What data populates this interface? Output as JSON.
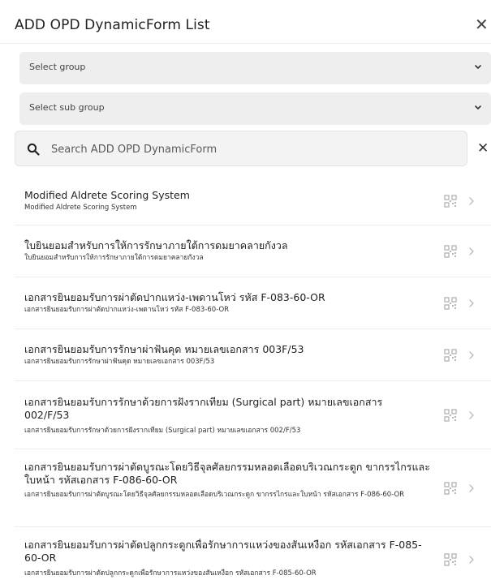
{
  "header": {
    "title": "ADD OPD DynamicForm List",
    "close_icon": "close-icon"
  },
  "filters": {
    "group_placeholder": "Select group",
    "sub_group_placeholder": "Select sub group"
  },
  "search": {
    "placeholder": "Search ADD OPD DynamicForm"
  },
  "items": [
    {
      "title": "Modified Aldrete Scoring System",
      "subtitle": "Modified Aldrete Scoring System"
    },
    {
      "title": "ใบยินยอมสำหรับการให้การรักษาภายใต้การดมยาคลายกังวล",
      "subtitle": "ใบยินยอมสำหรับการให้การรักษาภายใต้การดมยาคลายกังวล"
    },
    {
      "title": "เอกสารยินยอมรับการผ่าตัดปากแหว่ง-เพดานโหว่ รหัส F-083-60-OR",
      "subtitle": "เอกสารยินยอมรับการผ่าตัดปากแหว่ง-เพดานโหว่ รหัส F-083-60-OR"
    },
    {
      "title": "เอกสารยินยอมรับการรักษาผ่าฟันคุด หมายเลขเอกสาร 003F/53",
      "subtitle": "เอกสารยินยอมรับการรักษาผ่าฟันคุด หมายเลขเอกสาร 003F/53"
    },
    {
      "title": "เอกสารยินยอมรับการรักษาด้วยการฝังรากเทียม (Surgical part) หมายเลขเอกสาร 002/F/53",
      "subtitle": "เอกสารยินยอมรับการรักษาด้วยการฝังรากเทียม (Surgical part) หมายเลขเอกสาร 002/F/53"
    },
    {
      "title": "เอกสารยินยอมรับการผ่าตัดบูรณะโดยวิธีจุลศัลยกรรมหลอดเลือดบริเวณกระดูก ขากรรไกรและใบหน้า รหัสเอกสาร F-086-60-OR",
      "subtitle": "เอกสารยินยอมรับการผ่าตัดบูรณะโดยวิธีจุลศัลยกรรมหลอดเลือดบริเวณกระดูก ขากรรไกรและใบหน้า รหัสเอกสาร F-086-60-OR"
    },
    {
      "title": "เอกสารยินยอมรับการผ่าตัดปลูกกระดูกเพื่อรักษาการแหว่งของสันเหงือก รหัสเอกสาร F-085-60-OR",
      "subtitle": "เอกสารยินยอมรับการผ่าตัดปลูกกระดูกเพื่อรักษาการแหว่งของสันเหงือก รหัสเอกสาร F-085-60-OR"
    }
  ],
  "icons": {
    "qr": "qr-code-icon",
    "arrow": "chevron-right-icon",
    "search": "search-icon",
    "dropdown": "chevron-down-icon"
  }
}
